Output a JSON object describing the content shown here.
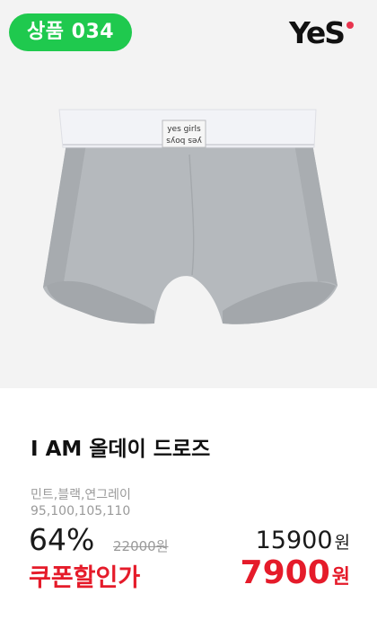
{
  "badge": {
    "label": "상품 034",
    "color": "#1fc94e"
  },
  "logo": {
    "text": "YeS",
    "dot_color": "#e8344e"
  },
  "product": {
    "image_icon": "boxer-briefs-image",
    "waistband_text_1": "yes girls",
    "waistband_text_2": "yes boys",
    "title": "I AM 올데이 드로즈",
    "colors": "민트,블랙,연그레이",
    "sizes": "95,100,105,110"
  },
  "pricing": {
    "discount_rate": "64%",
    "original_price": "22000원",
    "sale_price": "15900",
    "sale_price_unit": "원",
    "coupon_label": "쿠폰할인가",
    "coupon_price": "7900",
    "coupon_price_unit": "원",
    "accent_color": "#e51b2a"
  }
}
